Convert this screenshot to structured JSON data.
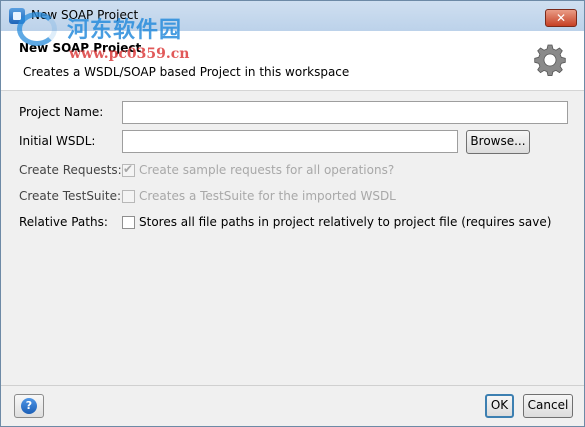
{
  "window": {
    "title": "New SOAP Project",
    "close_label": "✕"
  },
  "watermark": {
    "cn_text": "河东软件园",
    "url": "www.pc0359.cn"
  },
  "banner": {
    "title": "New SOAP Project",
    "subtitle": "Creates a WSDL/SOAP based Project in this workspace",
    "icon": "gear-icon"
  },
  "form": {
    "project_name_label": "Project Name:",
    "project_name_value": "",
    "initial_wsdl_label": "Initial WSDL:",
    "initial_wsdl_value": "",
    "browse_label": "Browse...",
    "create_requests_label": "Create Requests:",
    "create_requests_text": "Create sample requests for all operations?",
    "create_requests_checked": true,
    "create_testsuite_label": "Create TestSuite:",
    "create_testsuite_text": "Creates a TestSuite for the imported WSDL",
    "create_testsuite_checked": false,
    "relative_paths_label": "Relative Paths:",
    "relative_paths_text": "Stores all file paths in project relatively to project file (requires save)",
    "relative_paths_checked": false
  },
  "footer": {
    "help_label": "?",
    "ok_label": "OK",
    "cancel_label": "Cancel"
  },
  "colors": {
    "titlebar": "#bcd2ea",
    "close_button": "#c64024",
    "default_button_border": "#3c7fb1"
  }
}
